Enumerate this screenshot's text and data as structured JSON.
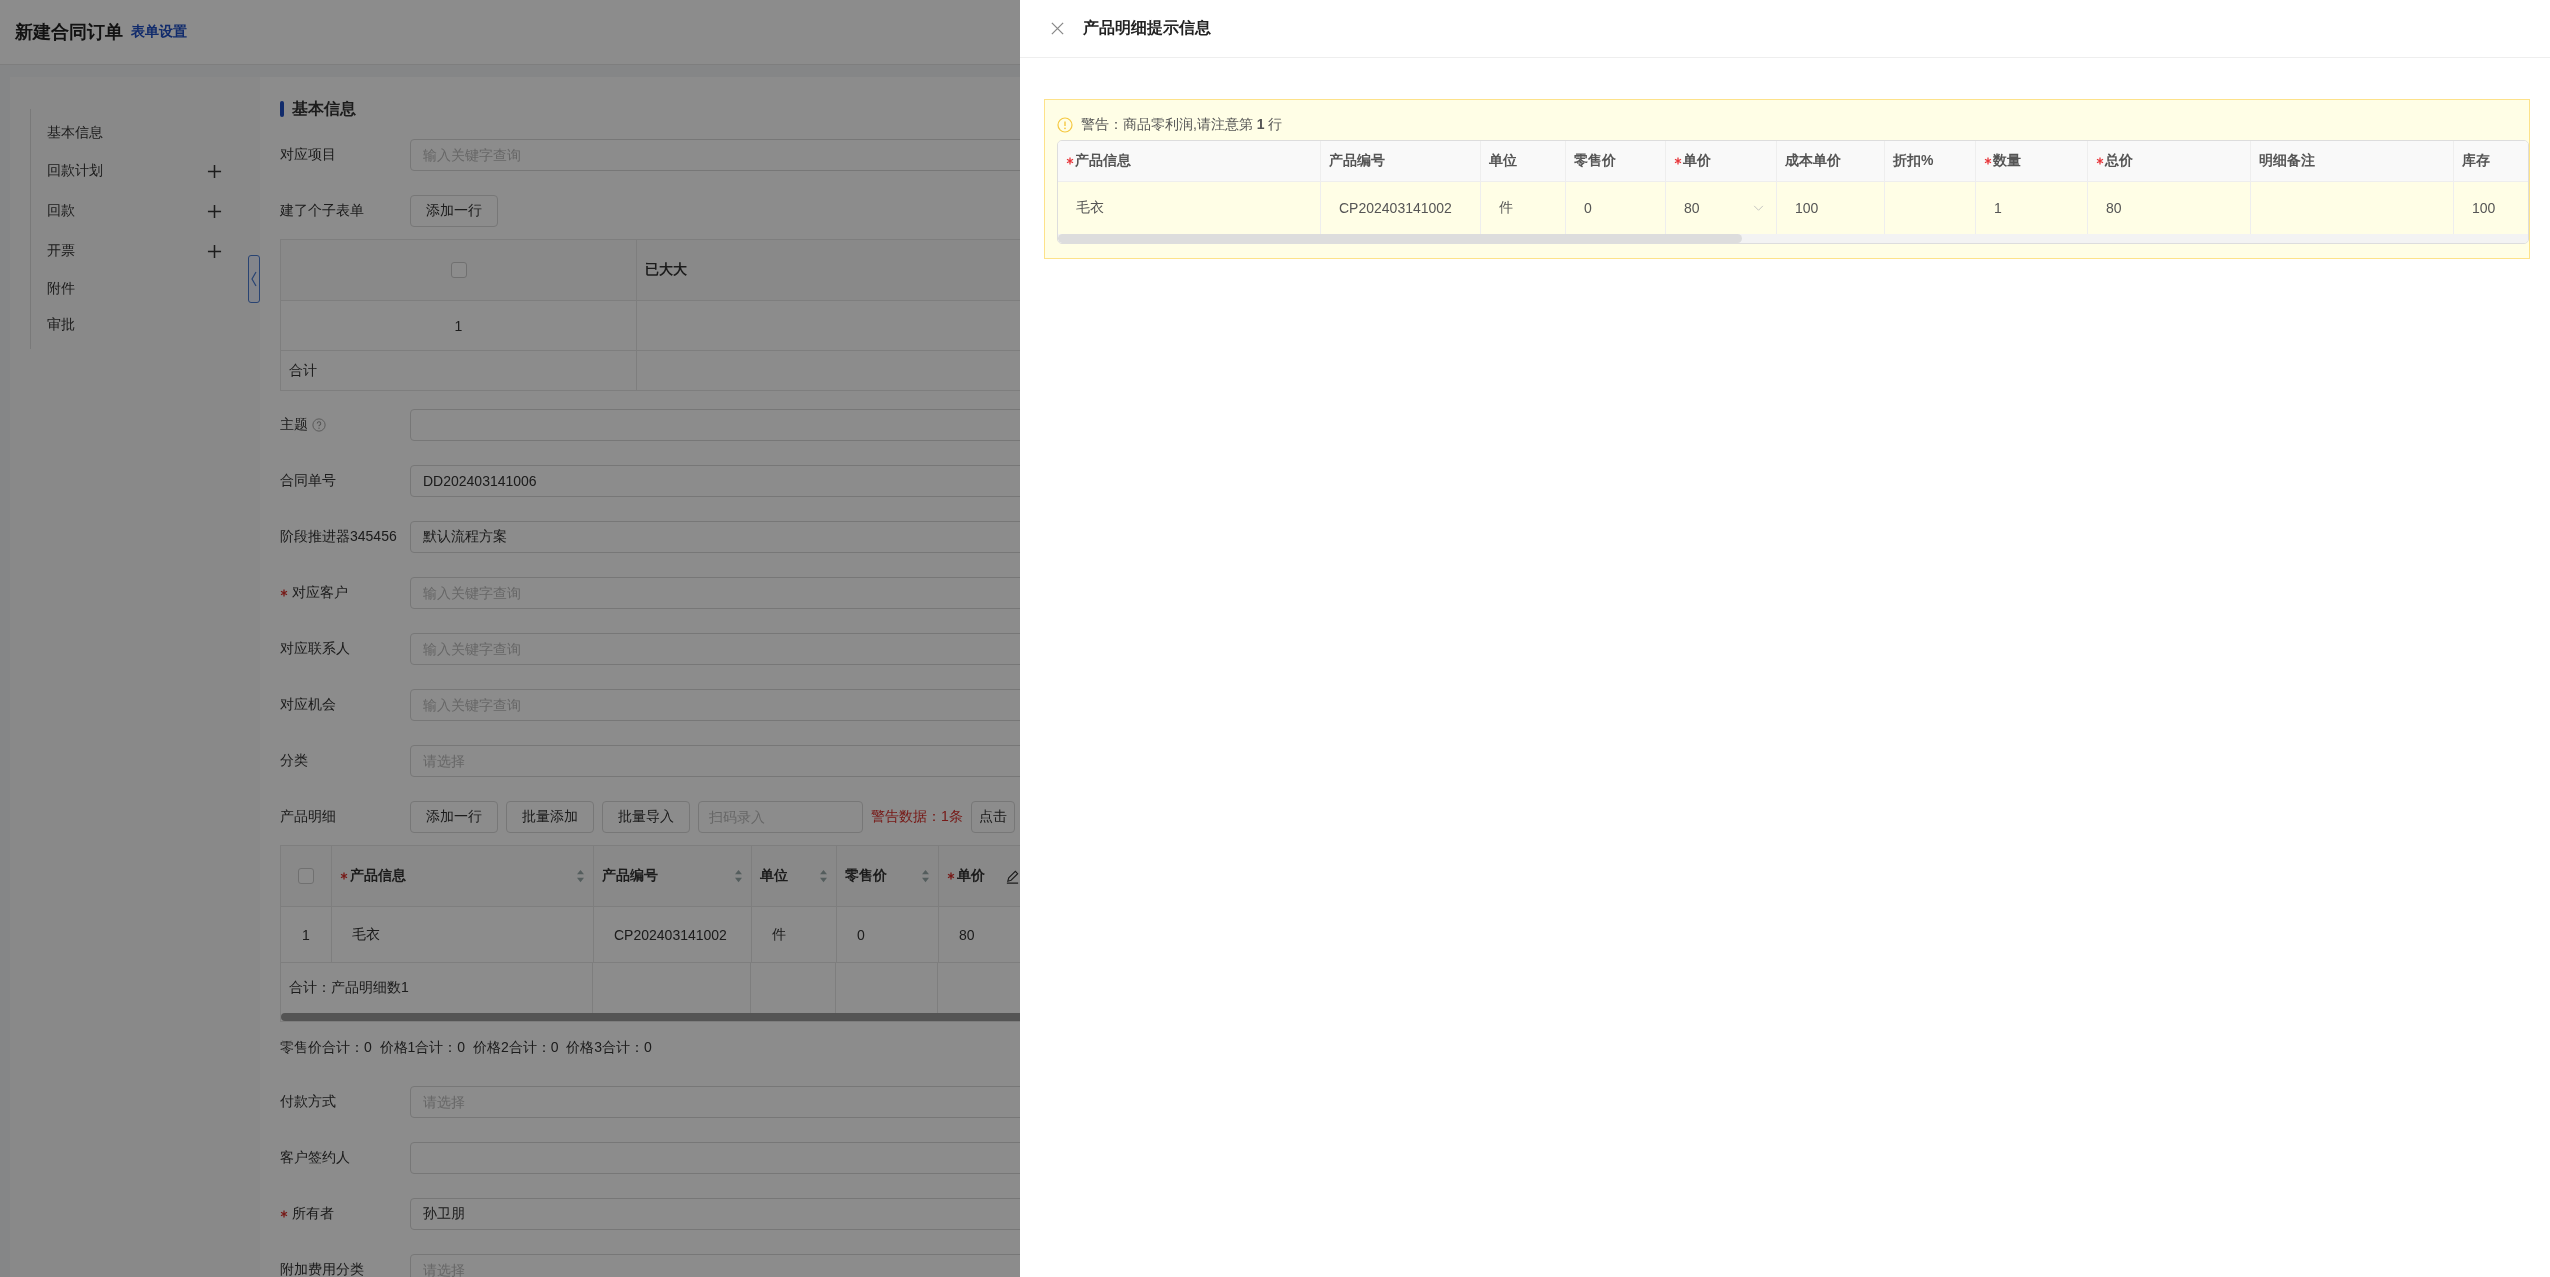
{
  "header": {
    "title": "新建合同订单",
    "link": "表单设置"
  },
  "sidebar": [
    {
      "label": "基本信息",
      "addable": false
    },
    {
      "label": "回款计划",
      "addable": true
    },
    {
      "label": "回款",
      "addable": true
    },
    {
      "label": "开票",
      "addable": true
    },
    {
      "label": "附件",
      "addable": false
    },
    {
      "label": "审批",
      "addable": false
    }
  ],
  "section": "基本信息",
  "form_rows": [
    {
      "kind": "field",
      "label": "对应项目",
      "required": false,
      "help": false,
      "placeholder": "输入关键字查询"
    },
    {
      "kind": "subtable",
      "label": "建了个子表单",
      "button": "添加一行",
      "checked": false,
      "column": "已大大",
      "row_index": "1",
      "footer": "合计"
    },
    {
      "kind": "field",
      "label": "主题",
      "required": false,
      "help": true
    },
    {
      "kind": "field",
      "label": "合同单号",
      "required": false,
      "help": false,
      "value": "DD202403141006"
    },
    {
      "kind": "field",
      "label": "阶段推进器345456",
      "required": false,
      "help": false,
      "value": "默认流程方案"
    },
    {
      "kind": "field",
      "label": "对应客户",
      "required": true,
      "help": false,
      "placeholder": "输入关键字查询"
    },
    {
      "kind": "field",
      "label": "对应联系人",
      "required": false,
      "help": false,
      "placeholder": "输入关键字查询"
    },
    {
      "kind": "field",
      "label": "对应机会",
      "required": false,
      "help": false,
      "placeholder": "输入关键字查询"
    },
    {
      "kind": "field",
      "label": "分类",
      "required": false,
      "help": false,
      "placeholder": "请选择"
    },
    {
      "kind": "products",
      "label": "产品明细",
      "buttons": [
        "添加一行",
        "批量添加",
        "批量导入"
      ],
      "scan_placeholder": "扫码录入",
      "warning": "警告数据：1条",
      "extra_button": "点击",
      "checked": false,
      "columns": [
        {
          "label": "产品信息",
          "required": true,
          "sortable": true,
          "editable": false
        },
        {
          "label": "产品编号",
          "required": false,
          "sortable": true,
          "editable": false
        },
        {
          "label": "单位",
          "required": false,
          "sortable": true,
          "editable": false
        },
        {
          "label": "零售价",
          "required": false,
          "sortable": true,
          "editable": false
        },
        {
          "label": "单价",
          "required": true,
          "sortable": false,
          "editable": true
        }
      ],
      "rows": [
        {
          "index": "1",
          "cells": [
            "毛衣",
            "CP202403141002",
            "件",
            "0",
            "80"
          ]
        }
      ],
      "footer": "合计：产品明细数1"
    },
    {
      "kind": "totals",
      "text": "零售价合计：0  价格1合计：0  价格2合计：0  价格3合计：0"
    },
    {
      "kind": "field",
      "label": "付款方式",
      "required": false,
      "help": false,
      "placeholder": "请选择"
    },
    {
      "kind": "field",
      "label": "客户签约人",
      "required": false,
      "help": false
    },
    {
      "kind": "field",
      "label": "所有者",
      "required": true,
      "help": false,
      "value": "孙卫朋"
    },
    {
      "kind": "field",
      "label": "附加费用分类",
      "required": false,
      "help": false,
      "placeholder": "请选择"
    }
  ],
  "drawer": {
    "title": "产品明细提示信息",
    "alert": "警告：商品零利润,请注意第 **1** 行",
    "columns": [
      {
        "label": "产品信息",
        "required": true
      },
      {
        "label": "产品编号",
        "required": false
      },
      {
        "label": "单位",
        "required": false
      },
      {
        "label": "零售价",
        "required": false
      },
      {
        "label": "单价",
        "required": true
      },
      {
        "label": "成本单价",
        "required": false
      },
      {
        "label": "折扣%",
        "required": false
      },
      {
        "label": "数量",
        "required": true
      },
      {
        "label": "总价",
        "required": true
      },
      {
        "label": "明细备注",
        "required": false
      },
      {
        "label": "库存",
        "required": false
      }
    ],
    "rows": [
      {
        "cells": [
          {
            "kind": "text",
            "text": "毛衣"
          },
          {
            "kind": "text",
            "text": "CP202403141002"
          },
          {
            "kind": "text",
            "text": "件"
          },
          {
            "kind": "text",
            "text": "0"
          },
          {
            "kind": "select",
            "text": "80"
          },
          {
            "kind": "text",
            "text": "100"
          },
          {
            "kind": "blank"
          },
          {
            "kind": "text",
            "text": "1"
          },
          {
            "kind": "text",
            "text": "80"
          },
          {
            "kind": "blank"
          },
          {
            "kind": "text",
            "text": "100"
          }
        ]
      }
    ]
  }
}
